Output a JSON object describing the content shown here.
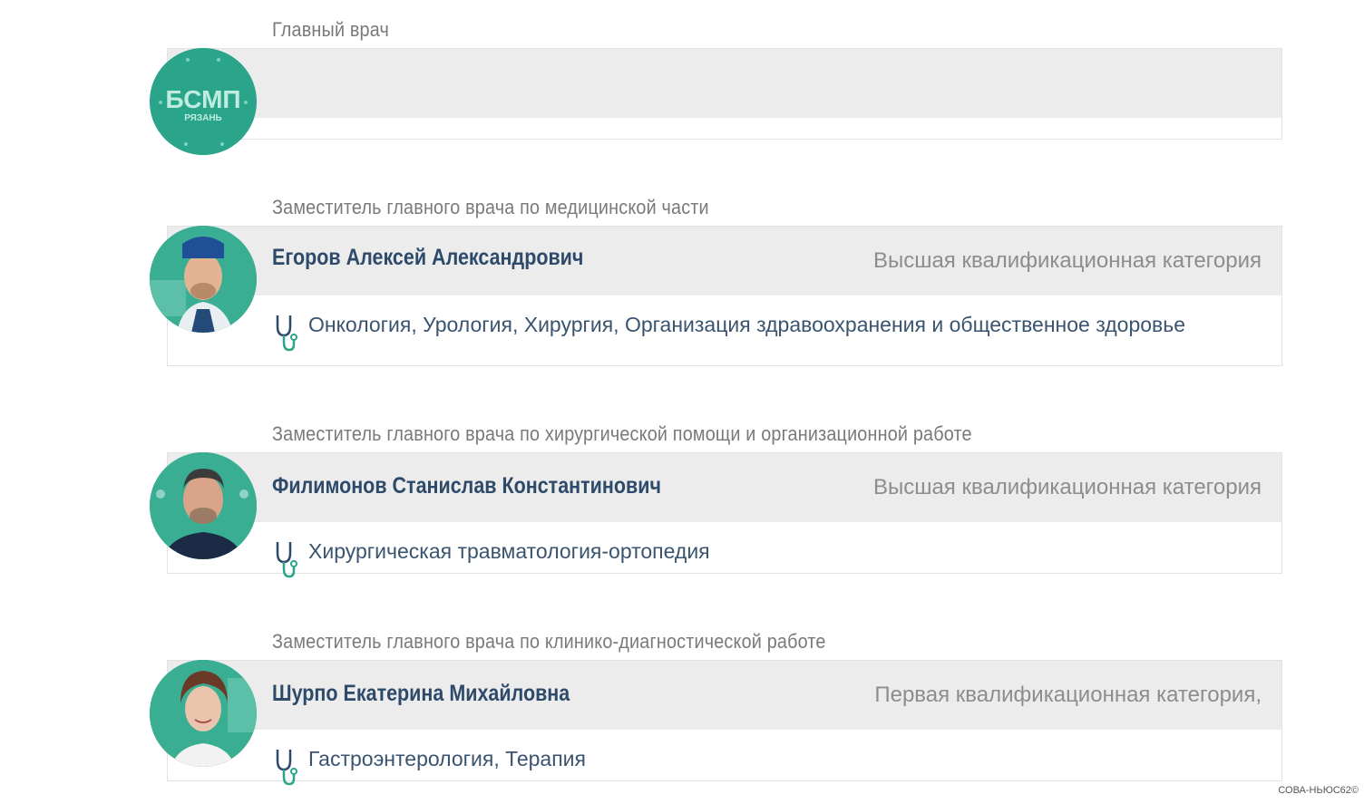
{
  "colors": {
    "teal": "#2aa58a",
    "header_bg": "#ececec",
    "name": "#2e4a6a",
    "category": "#8d8d8d",
    "role": "#7a7a7a"
  },
  "chief": {
    "role": "Главный врач",
    "logo_main": "БСМП",
    "logo_sub": "РЯЗАНЬ"
  },
  "doctors": [
    {
      "role": "Заместитель главного врача по медицинской части",
      "name": "Егоров Алексей Александрович",
      "category": "Высшая квалификационная категория",
      "specialties": "Онкология, Урология, Хирургия, Организация здравоохранения и общественное здоровье",
      "icon": "stethoscope-icon"
    },
    {
      "role": "Заместитель главного врача по хирургической помощи и организационной работе",
      "name": "Филимонов Станислав Константинович",
      "category": "Высшая квалификационная категория",
      "specialties": "Хирургическая травматология-ортопедия",
      "icon": "stethoscope-icon"
    },
    {
      "role": "Заместитель главного врача по клинико-диагностической работе",
      "name": "Шурпо Екатерина Михайловна",
      "category": "Первая квалификационная категория,",
      "specialties": "Гастроэнтерология, Терапия",
      "icon": "stethoscope-icon"
    }
  ],
  "watermark": "СОВА-НЬЮС62©"
}
